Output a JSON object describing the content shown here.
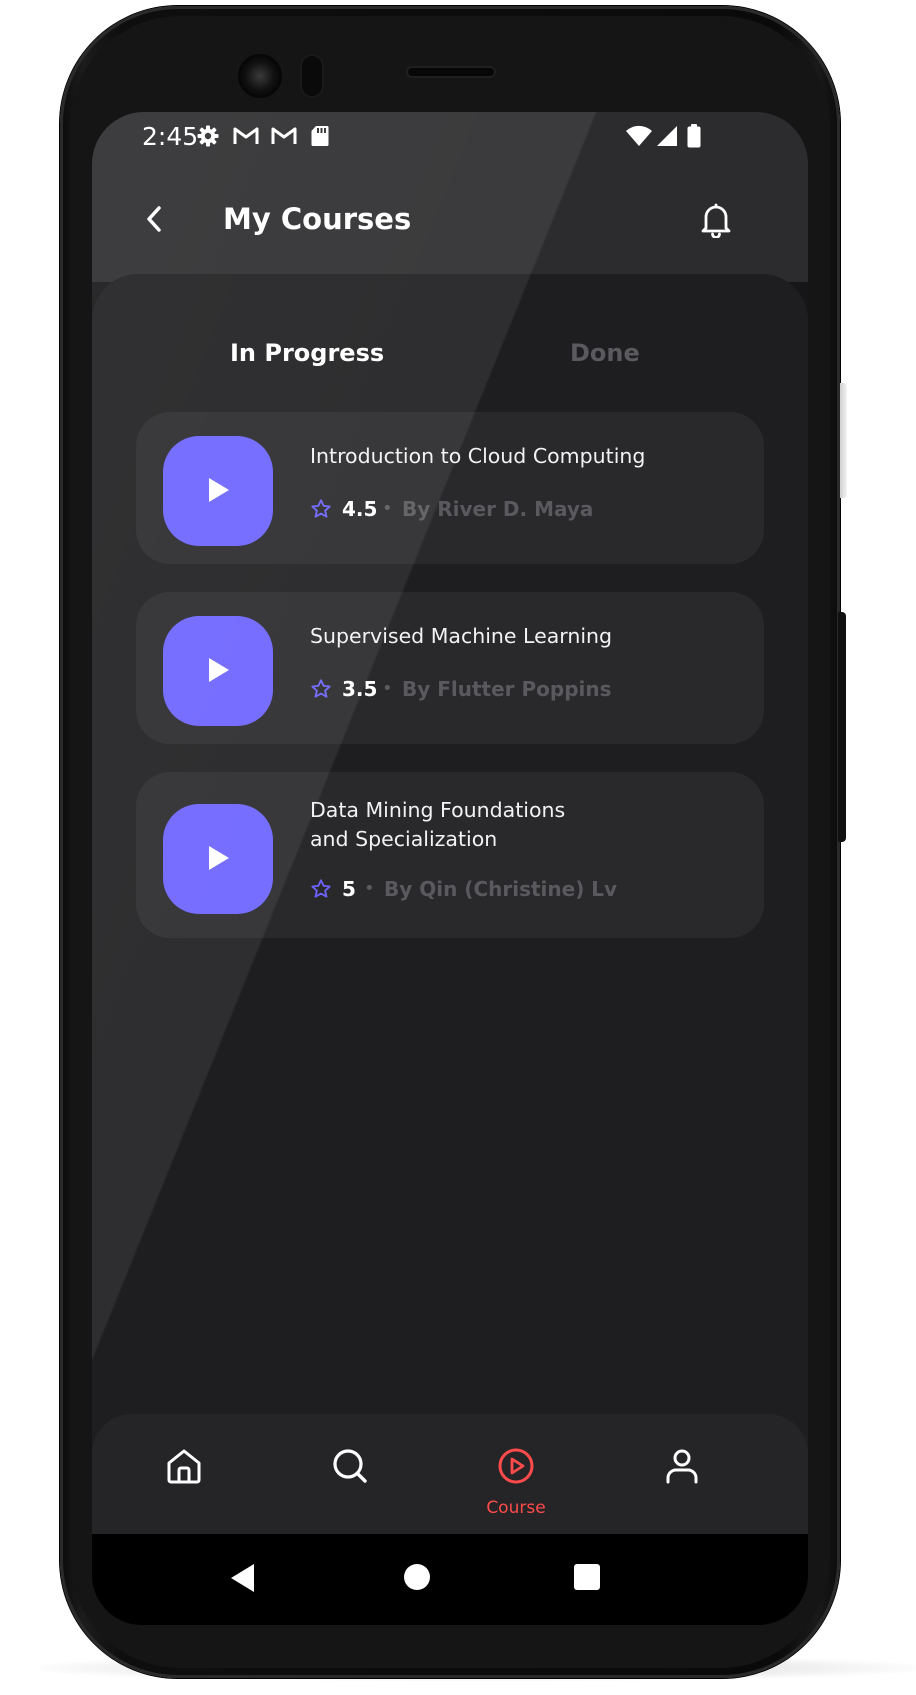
{
  "status_bar": {
    "time": "2:45"
  },
  "app_bar": {
    "title": "My Courses"
  },
  "tabs": [
    {
      "label": "In Progress",
      "active": true
    },
    {
      "label": "Done",
      "active": false
    }
  ],
  "courses": [
    {
      "title": "Introduction to Cloud Computing",
      "rating": "4.5",
      "author": "By River D. Maya"
    },
    {
      "title": "Supervised Machine Learning",
      "rating": "3.5",
      "author": "By Flutter Poppins"
    },
    {
      "title": "Data Mining Foundations and Specialization",
      "rating": "5",
      "author": "By Qin (Christine) Lv"
    }
  ],
  "bottom_nav": {
    "items": [
      {
        "icon": "home-icon",
        "label": "",
        "active": false
      },
      {
        "icon": "search-icon",
        "label": "",
        "active": false
      },
      {
        "icon": "play-circle-icon",
        "label": "Course",
        "active": true
      },
      {
        "icon": "profile-icon",
        "label": "",
        "active": false
      }
    ]
  },
  "colors": {
    "accent": "#6c63ff",
    "active_nav": "#ff4b4b",
    "background": "#1e1e20",
    "card": "#29292c",
    "muted_text": "#5a5a5e"
  }
}
